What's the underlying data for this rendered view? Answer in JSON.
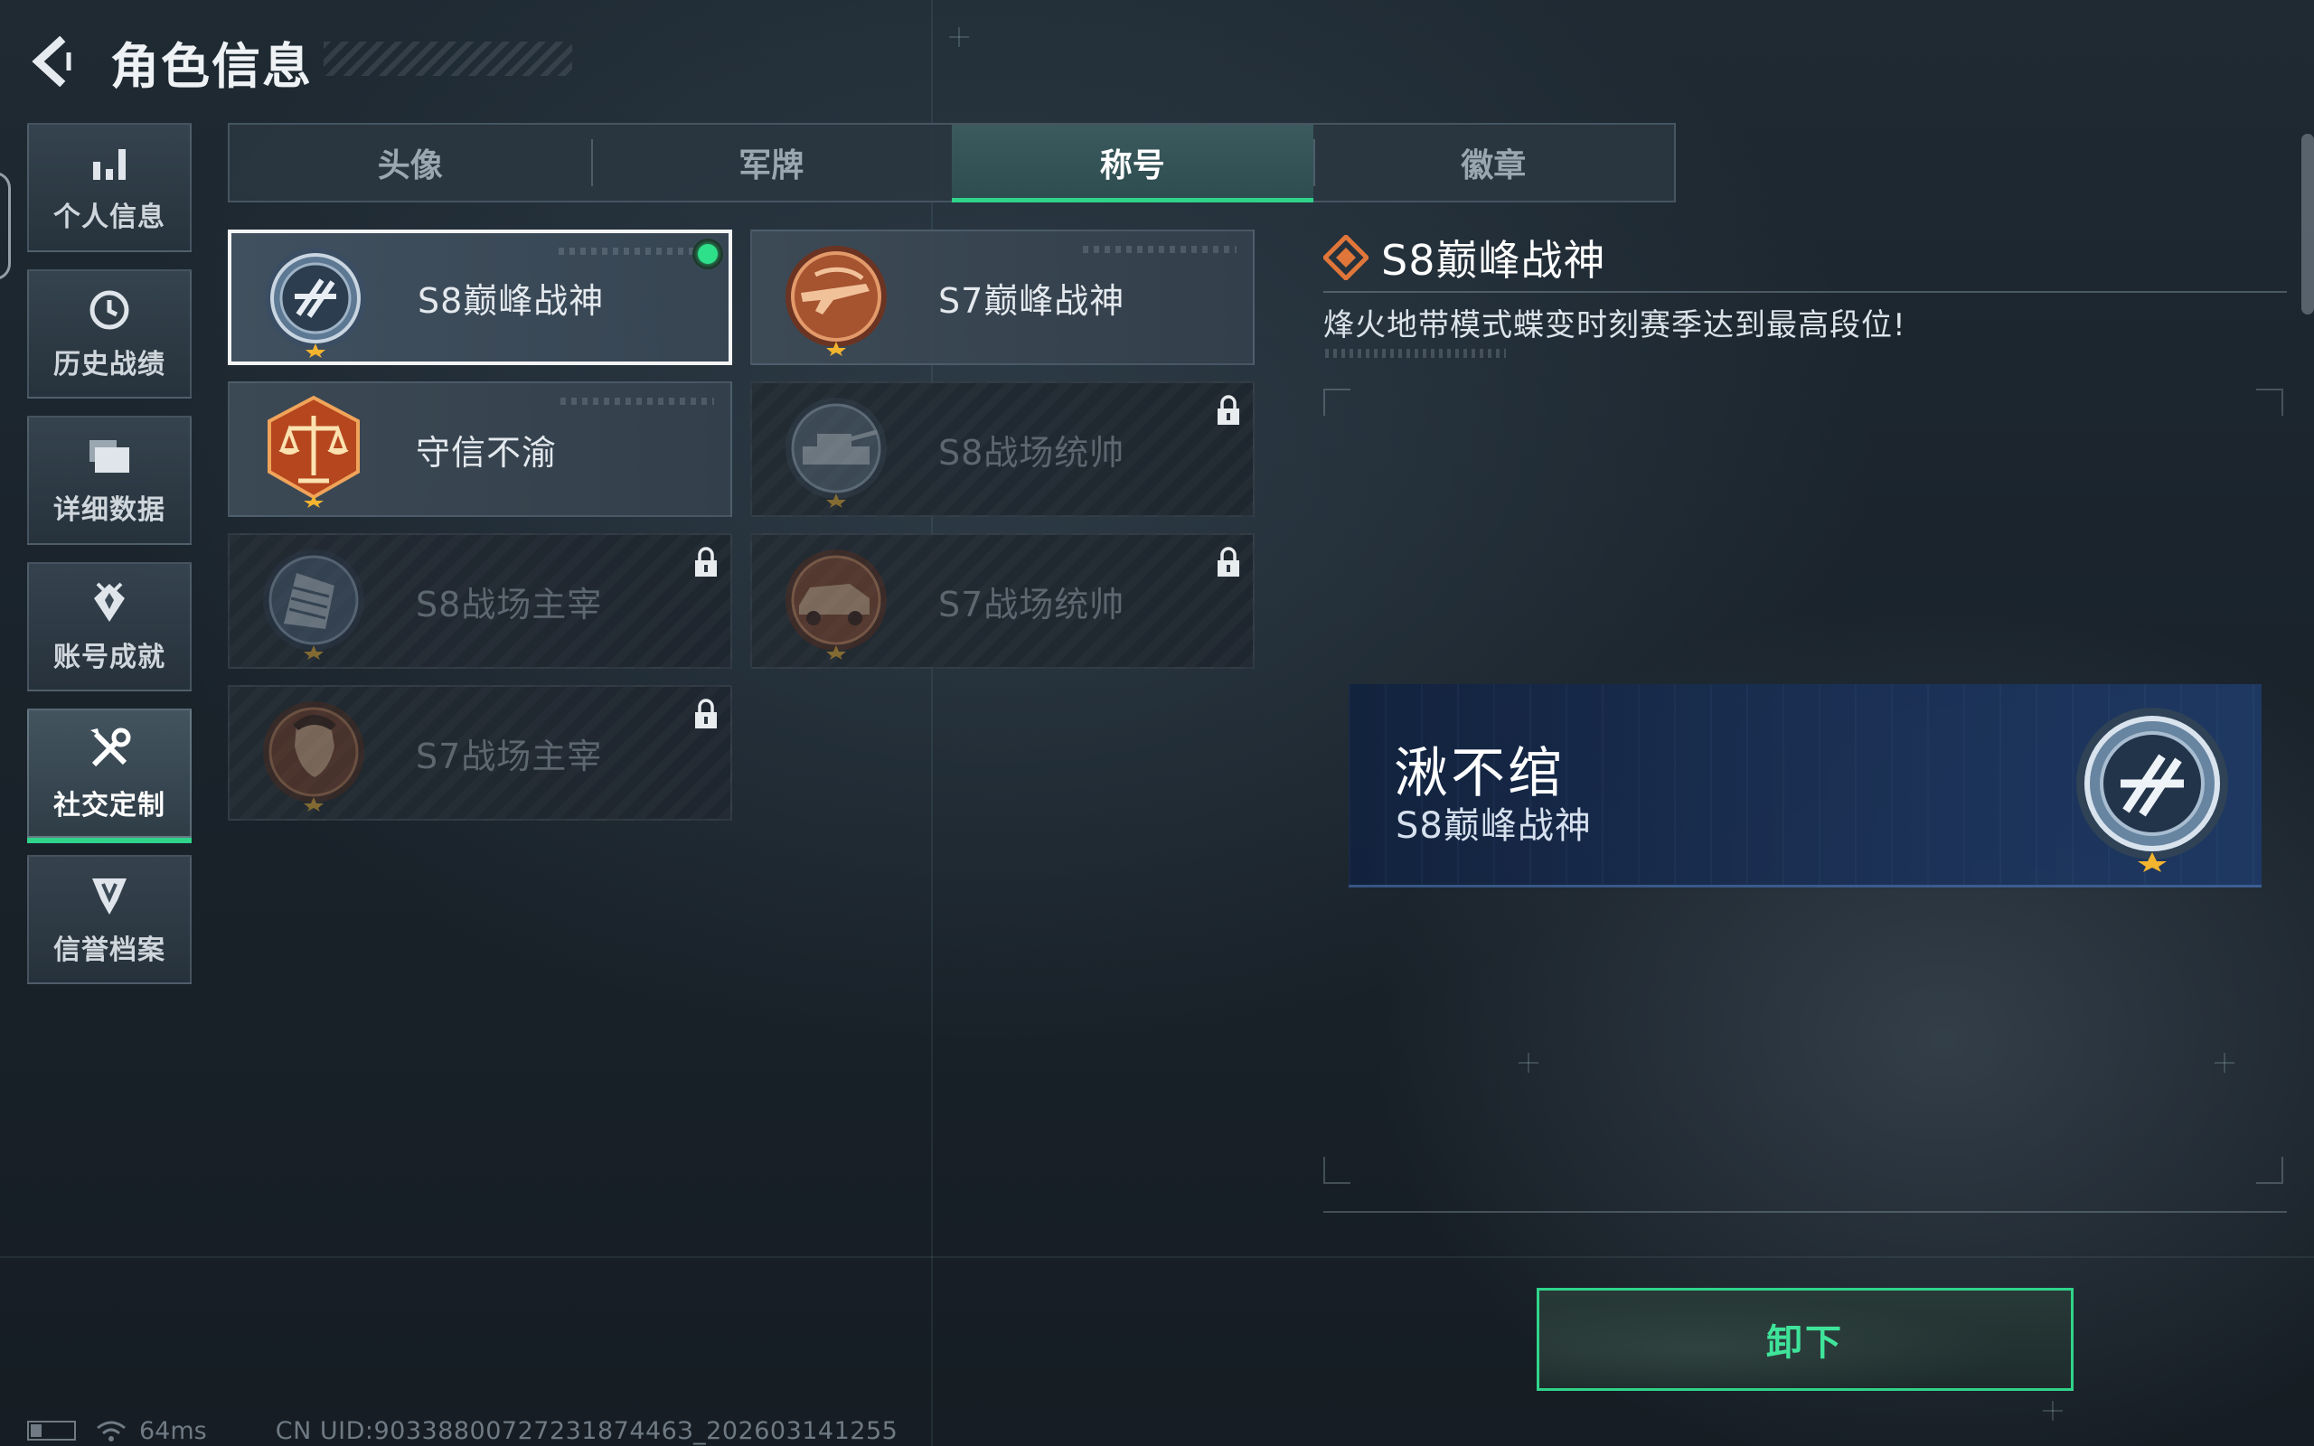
{
  "header": {
    "title": "角色信息"
  },
  "sidebar": {
    "items": [
      {
        "label": "个人信息",
        "icon": "bar-chart-icon",
        "active": false
      },
      {
        "label": "历史战绩",
        "icon": "history-clock-icon",
        "active": false
      },
      {
        "label": "详细数据",
        "icon": "folder-icon",
        "active": false
      },
      {
        "label": "账号成就",
        "icon": "achievement-icon",
        "active": false
      },
      {
        "label": "社交定制",
        "icon": "tools-icon",
        "active": true
      },
      {
        "label": "信誉档案",
        "icon": "credit-shield-icon",
        "active": false
      }
    ]
  },
  "tabs": [
    {
      "label": "头像",
      "active": false
    },
    {
      "label": "军牌",
      "active": false
    },
    {
      "label": "称号",
      "active": true
    },
    {
      "label": "徽章",
      "active": false
    }
  ],
  "titles": [
    {
      "name": "S8巅峰战神",
      "emblem": "peak-god-emblem",
      "locked": false,
      "selected": true,
      "equipped": true
    },
    {
      "name": "S7巅峰战神",
      "emblem": "rifle-emblem",
      "locked": false,
      "selected": false,
      "equipped": false
    },
    {
      "name": "守信不渝",
      "emblem": "scales-emblem",
      "locked": false,
      "selected": false,
      "equipped": false
    },
    {
      "name": "S8战场统帅",
      "emblem": "tank-emblem",
      "locked": true,
      "selected": false,
      "equipped": false
    },
    {
      "name": "S8战场主宰",
      "emblem": "building-emblem",
      "locked": true,
      "selected": false,
      "equipped": false
    },
    {
      "name": "S7战场统帅",
      "emblem": "vehicle-emblem",
      "locked": true,
      "selected": false,
      "equipped": false
    },
    {
      "name": "S7战场主宰",
      "emblem": "soldier-emblem",
      "locked": true,
      "selected": false,
      "equipped": false
    }
  ],
  "detail": {
    "title": "S8巅峰战神",
    "description": "烽火地带模式蝶变时刻赛季达到最高段位!"
  },
  "preview": {
    "player_name": "湫不绾",
    "title": "S8巅峰战神"
  },
  "actions": {
    "unequip_label": "卸下"
  },
  "status": {
    "ping": "64ms",
    "uid": "CN UID:9033880072723187446З_202603141255"
  },
  "colors": {
    "accent": "#2fd48a",
    "preview_bg": "#1a3056",
    "emblem_orange": "#e0763a"
  }
}
